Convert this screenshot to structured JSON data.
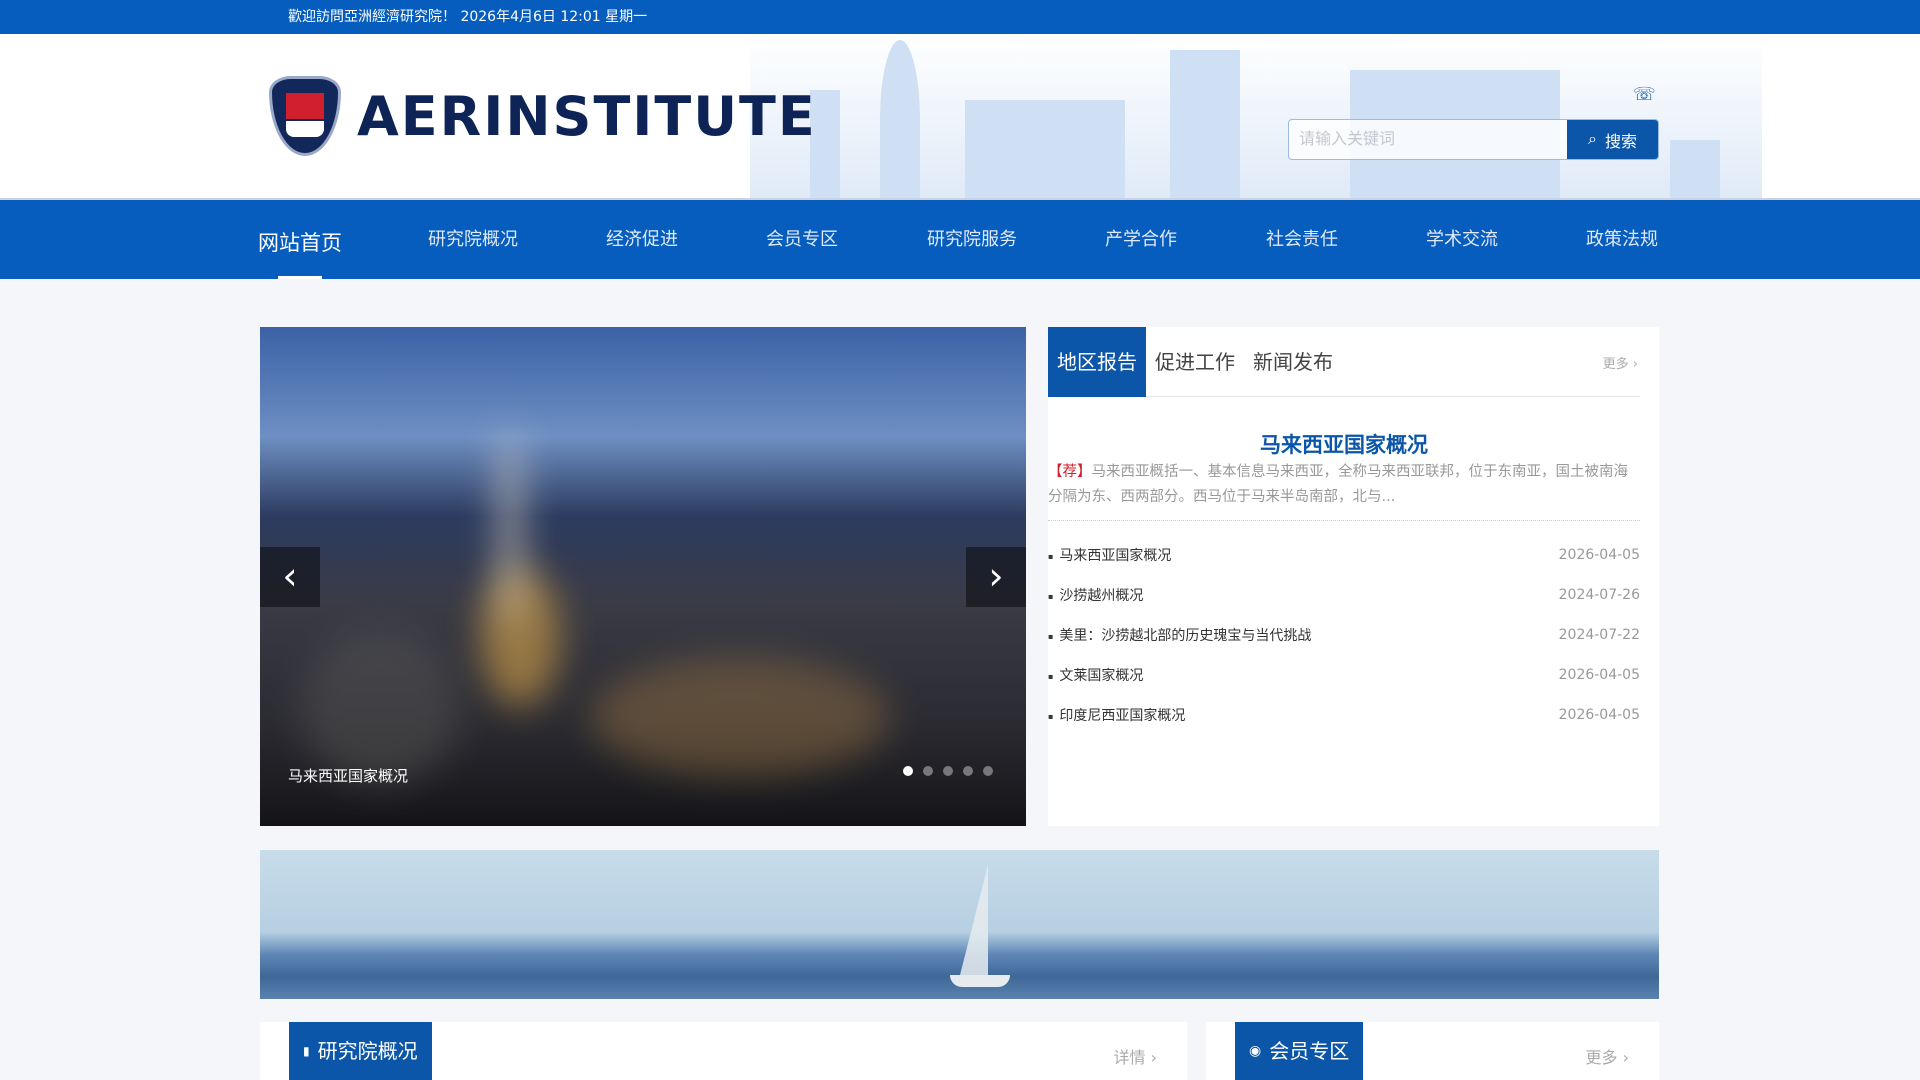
{
  "topbar": {
    "welcome": "歡迎訪問亞洲經濟研究院！ 2026年4月6日 12:01 星期一"
  },
  "header": {
    "logo_text": "AERINSTITUTE",
    "search_placeholder": "请输入关键词",
    "search_label": "搜索",
    "phone_icon": "phone-icon"
  },
  "nav": [
    {
      "label": "网站首页"
    },
    {
      "label": "研究院概况"
    },
    {
      "label": "经济促进"
    },
    {
      "label": "会员专区"
    },
    {
      "label": "研究院服务"
    },
    {
      "label": "产学合作"
    },
    {
      "label": "社会责任"
    },
    {
      "label": "学术交流"
    },
    {
      "label": "政策法规"
    }
  ],
  "slider": {
    "caption": "马来西亚国家概况",
    "prev": "‹",
    "next": "›",
    "dots": 5,
    "active_dot": 1
  },
  "news": {
    "tabs": [
      {
        "label": "地区报告"
      },
      {
        "label": "促进工作"
      },
      {
        "label": "新闻发布"
      }
    ],
    "more": "更多 ›",
    "featured": {
      "title": "马来西亚国家概况",
      "tag": "【荐】",
      "desc": "马来西亚概括一、基本信息马来西亚，全称马来西亚联邦，位于东南亚，国土被南海分隔为东、西两部分。西马位于马来半岛南部，北与..."
    },
    "items": [
      {
        "title": "马来西亚国家概况",
        "date": "2026-04-05"
      },
      {
        "title": "沙捞越州概况",
        "date": "2024-07-26"
      },
      {
        "title": "美里：沙捞越北部的历史瑰宝与当代挑战",
        "date": "2024-07-22"
      },
      {
        "title": "文莱国家概况",
        "date": "2026-04-05"
      },
      {
        "title": "印度尼西亚国家概况",
        "date": "2026-04-05"
      }
    ]
  },
  "cards": {
    "about": {
      "title": "研究院概况",
      "link": "详情 ›"
    },
    "member": {
      "title": "会员专区",
      "link": "更多 ›"
    }
  },
  "colors": {
    "primary": "#065dbd",
    "accent": "#0b56a8",
    "tag": "#d21f2e"
  }
}
